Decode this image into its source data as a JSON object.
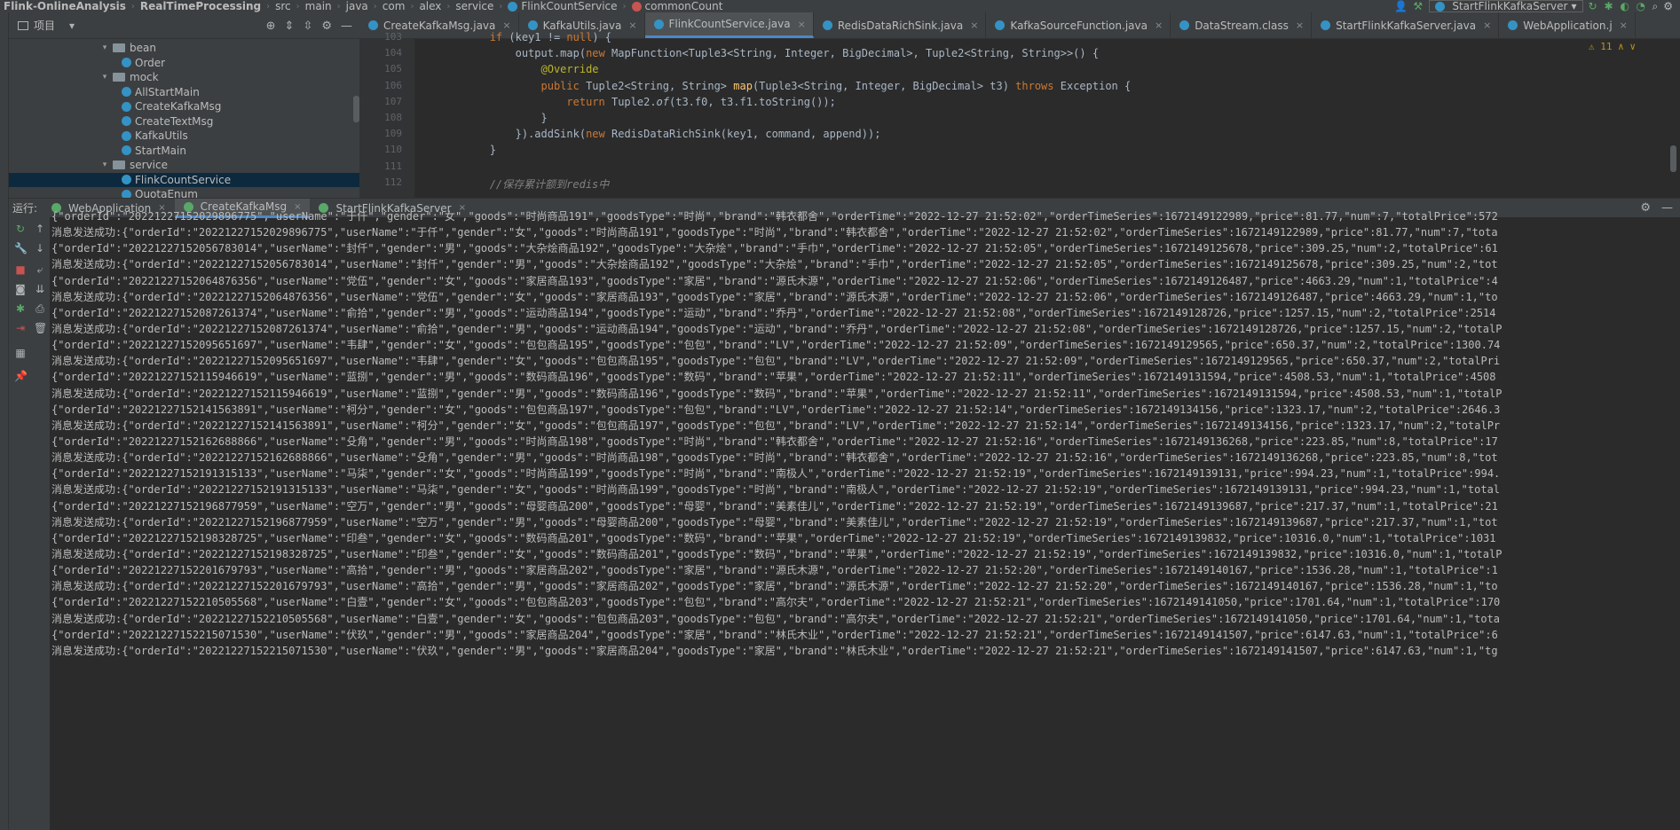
{
  "nav": {
    "crumbs": [
      "Flink-OnlineAnalysis",
      "RealTimeProcessing",
      "src",
      "main",
      "java",
      "com",
      "alex",
      "service",
      "FlinkCountService",
      "commonCount"
    ],
    "run_config": "StartFlinkKafkaServer"
  },
  "project": {
    "title": "项目",
    "tree": [
      {
        "label": "bean",
        "type": "folder",
        "indent": 1
      },
      {
        "label": "Order",
        "type": "class",
        "indent": 2
      },
      {
        "label": "mock",
        "type": "folder",
        "indent": 1
      },
      {
        "label": "AllStartMain",
        "type": "class",
        "indent": 2
      },
      {
        "label": "CreateKafkaMsg",
        "type": "class",
        "indent": 2
      },
      {
        "label": "CreateTextMsg",
        "type": "class",
        "indent": 2
      },
      {
        "label": "KafkaUtils",
        "type": "class",
        "indent": 2
      },
      {
        "label": "StartMain",
        "type": "class",
        "indent": 2
      },
      {
        "label": "service",
        "type": "folder",
        "indent": 1
      },
      {
        "label": "FlinkCountService",
        "type": "class",
        "indent": 2,
        "selected": true
      },
      {
        "label": "QuotaEnum",
        "type": "class",
        "indent": 2
      }
    ]
  },
  "editor": {
    "tabs": [
      {
        "label": "CreateKafkaMsg.java",
        "active": false
      },
      {
        "label": "KafkaUtils.java",
        "active": false
      },
      {
        "label": "FlinkCountService.java",
        "active": true
      },
      {
        "label": "RedisDataRichSink.java",
        "active": false
      },
      {
        "label": "KafkaSourceFunction.java",
        "active": false
      },
      {
        "label": "DataStream.class",
        "active": false
      },
      {
        "label": "StartFlinkKafkaServer.java",
        "active": false
      },
      {
        "label": "WebApplication.j",
        "active": false
      }
    ],
    "warning_count": "11",
    "line_numbers": [
      "103",
      "104",
      "105",
      "106",
      "107",
      "108",
      "109",
      "110",
      "111",
      "112"
    ],
    "lines": [
      "            if (key1 != null) {",
      "                output.map(new MapFunction<Tuple3<String, Integer, BigDecimal>, Tuple2<String, String>>() {",
      "                    @Override",
      "                    public Tuple2<String, String> map(Tuple3<String, Integer, BigDecimal> t3) throws Exception {",
      "                        return Tuple2.of(t3.f0, t3.f1.toString());",
      "                    }",
      "                }).addSink(new RedisDataRichSink(key1, command, append));",
      "            }",
      "",
      "            //保存累计额到redis中"
    ]
  },
  "run": {
    "label": "运行:",
    "tabs": [
      {
        "label": "WebApplication",
        "active": false
      },
      {
        "label": "CreateKafkaMsg",
        "active": true
      },
      {
        "label": "StartFlinkKafkaServer",
        "active": false
      }
    ],
    "console": [
      "{\"orderId\":\"20221227152029896775\",\"userName\":\"于仟\",\"gender\":\"女\",\"goods\":\"时尚商品191\",\"goodsType\":\"时尚\",\"brand\":\"韩衣都舍\",\"orderTime\":\"2022-12-27 21:52:02\",\"orderTimeSeries\":1672149122989,\"price\":81.77,\"num\":7,\"totalPrice\":572",
      "消息发送成功:{\"orderId\":\"20221227152029896775\",\"userName\":\"于仟\",\"gender\":\"女\",\"goods\":\"时尚商品191\",\"goodsType\":\"时尚\",\"brand\":\"韩衣都舍\",\"orderTime\":\"2022-12-27 21:52:02\",\"orderTimeSeries\":1672149122989,\"price\":81.77,\"num\":7,\"tota",
      "{\"orderId\":\"20221227152056783014\",\"userName\":\"封仟\",\"gender\":\"男\",\"goods\":\"大杂烩商品192\",\"goodsType\":\"大杂烩\",\"brand\":\"手巾\",\"orderTime\":\"2022-12-27 21:52:05\",\"orderTimeSeries\":1672149125678,\"price\":309.25,\"num\":2,\"totalPrice\":61",
      "消息发送成功:{\"orderId\":\"20221227152056783014\",\"userName\":\"封仟\",\"gender\":\"男\",\"goods\":\"大杂烩商品192\",\"goodsType\":\"大杂烩\",\"brand\":\"手巾\",\"orderTime\":\"2022-12-27 21:52:05\",\"orderTimeSeries\":1672149125678,\"price\":309.25,\"num\":2,\"tot",
      "{\"orderId\":\"20221227152064876356\",\"userName\":\"党伍\",\"gender\":\"女\",\"goods\":\"家居商品193\",\"goodsType\":\"家居\",\"brand\":\"源氏木源\",\"orderTime\":\"2022-12-27 21:52:06\",\"orderTimeSeries\":1672149126487,\"price\":4663.29,\"num\":1,\"totalPrice\":4",
      "消息发送成功:{\"orderId\":\"20221227152064876356\",\"userName\":\"党伍\",\"gender\":\"女\",\"goods\":\"家居商品193\",\"goodsType\":\"家居\",\"brand\":\"源氏木源\",\"orderTime\":\"2022-12-27 21:52:06\",\"orderTimeSeries\":1672149126487,\"price\":4663.29,\"num\":1,\"to",
      "{\"orderId\":\"20221227152087261374\",\"userName\":\"俞拾\",\"gender\":\"男\",\"goods\":\"运动商品194\",\"goodsType\":\"运动\",\"brand\":\"乔丹\",\"orderTime\":\"2022-12-27 21:52:08\",\"orderTimeSeries\":1672149128726,\"price\":1257.15,\"num\":2,\"totalPrice\":2514",
      "消息发送成功:{\"orderId\":\"20221227152087261374\",\"userName\":\"俞拾\",\"gender\":\"男\",\"goods\":\"运动商品194\",\"goodsType\":\"运动\",\"brand\":\"乔丹\",\"orderTime\":\"2022-12-27 21:52:08\",\"orderTimeSeries\":1672149128726,\"price\":1257.15,\"num\":2,\"totalP",
      "{\"orderId\":\"20221227152095651697\",\"userName\":\"韦肆\",\"gender\":\"女\",\"goods\":\"包包商品195\",\"goodsType\":\"包包\",\"brand\":\"LV\",\"orderTime\":\"2022-12-27 21:52:09\",\"orderTimeSeries\":1672149129565,\"price\":650.37,\"num\":2,\"totalPrice\":1300.74",
      "消息发送成功:{\"orderId\":\"20221227152095651697\",\"userName\":\"韦肆\",\"gender\":\"女\",\"goods\":\"包包商品195\",\"goodsType\":\"包包\",\"brand\":\"LV\",\"orderTime\":\"2022-12-27 21:52:09\",\"orderTimeSeries\":1672149129565,\"price\":650.37,\"num\":2,\"totalPri",
      "{\"orderId\":\"20221227152115946619\",\"userName\":\"蓝捌\",\"gender\":\"男\",\"goods\":\"数码商品196\",\"goodsType\":\"数码\",\"brand\":\"苹果\",\"orderTime\":\"2022-12-27 21:52:11\",\"orderTimeSeries\":1672149131594,\"price\":4508.53,\"num\":1,\"totalPrice\":4508",
      "消息发送成功:{\"orderId\":\"20221227152115946619\",\"userName\":\"蓝捌\",\"gender\":\"男\",\"goods\":\"数码商品196\",\"goodsType\":\"数码\",\"brand\":\"苹果\",\"orderTime\":\"2022-12-27 21:52:11\",\"orderTimeSeries\":1672149131594,\"price\":4508.53,\"num\":1,\"totalP",
      "{\"orderId\":\"20221227152141563891\",\"userName\":\"柯分\",\"gender\":\"女\",\"goods\":\"包包商品197\",\"goodsType\":\"包包\",\"brand\":\"LV\",\"orderTime\":\"2022-12-27 21:52:14\",\"orderTimeSeries\":1672149134156,\"price\":1323.17,\"num\":2,\"totalPrice\":2646.3",
      "消息发送成功:{\"orderId\":\"20221227152141563891\",\"userName\":\"柯分\",\"gender\":\"女\",\"goods\":\"包包商品197\",\"goodsType\":\"包包\",\"brand\":\"LV\",\"orderTime\":\"2022-12-27 21:52:14\",\"orderTimeSeries\":1672149134156,\"price\":1323.17,\"num\":2,\"totalPr",
      "{\"orderId\":\"20221227152162688866\",\"userName\":\"殳角\",\"gender\":\"男\",\"goods\":\"时尚商品198\",\"goodsType\":\"时尚\",\"brand\":\"韩衣都舍\",\"orderTime\":\"2022-12-27 21:52:16\",\"orderTimeSeries\":1672149136268,\"price\":223.85,\"num\":8,\"totalPrice\":17",
      "消息发送成功:{\"orderId\":\"20221227152162688866\",\"userName\":\"殳角\",\"gender\":\"男\",\"goods\":\"时尚商品198\",\"goodsType\":\"时尚\",\"brand\":\"韩衣都舍\",\"orderTime\":\"2022-12-27 21:52:16\",\"orderTimeSeries\":1672149136268,\"price\":223.85,\"num\":8,\"tot",
      "{\"orderId\":\"20221227152191315133\",\"userName\":\"马柒\",\"gender\":\"女\",\"goods\":\"时尚商品199\",\"goodsType\":\"时尚\",\"brand\":\"南极人\",\"orderTime\":\"2022-12-27 21:52:19\",\"orderTimeSeries\":1672149139131,\"price\":994.23,\"num\":1,\"totalPrice\":994.",
      "消息发送成功:{\"orderId\":\"20221227152191315133\",\"userName\":\"马柒\",\"gender\":\"女\",\"goods\":\"时尚商品199\",\"goodsType\":\"时尚\",\"brand\":\"南极人\",\"orderTime\":\"2022-12-27 21:52:19\",\"orderTimeSeries\":1672149139131,\"price\":994.23,\"num\":1,\"total",
      "{\"orderId\":\"20221227152196877959\",\"userName\":\"空万\",\"gender\":\"男\",\"goods\":\"母婴商品200\",\"goodsType\":\"母婴\",\"brand\":\"美素佳儿\",\"orderTime\":\"2022-12-27 21:52:19\",\"orderTimeSeries\":1672149139687,\"price\":217.37,\"num\":1,\"totalPrice\":21",
      "消息发送成功:{\"orderId\":\"20221227152196877959\",\"userName\":\"空万\",\"gender\":\"男\",\"goods\":\"母婴商品200\",\"goodsType\":\"母婴\",\"brand\":\"美素佳儿\",\"orderTime\":\"2022-12-27 21:52:19\",\"orderTimeSeries\":1672149139687,\"price\":217.37,\"num\":1,\"tot",
      "{\"orderId\":\"20221227152198328725\",\"userName\":\"印叁\",\"gender\":\"女\",\"goods\":\"数码商品201\",\"goodsType\":\"数码\",\"brand\":\"苹果\",\"orderTime\":\"2022-12-27 21:52:19\",\"orderTimeSeries\":1672149139832,\"price\":10316.0,\"num\":1,\"totalPrice\":1031",
      "消息发送成功:{\"orderId\":\"20221227152198328725\",\"userName\":\"印叁\",\"gender\":\"女\",\"goods\":\"数码商品201\",\"goodsType\":\"数码\",\"brand\":\"苹果\",\"orderTime\":\"2022-12-27 21:52:19\",\"orderTimeSeries\":1672149139832,\"price\":10316.0,\"num\":1,\"totalP",
      "{\"orderId\":\"20221227152201679793\",\"userName\":\"高拾\",\"gender\":\"男\",\"goods\":\"家居商品202\",\"goodsType\":\"家居\",\"brand\":\"源氏木源\",\"orderTime\":\"2022-12-27 21:52:20\",\"orderTimeSeries\":1672149140167,\"price\":1536.28,\"num\":1,\"totalPrice\":1",
      "消息发送成功:{\"orderId\":\"20221227152201679793\",\"userName\":\"高拾\",\"gender\":\"男\",\"goods\":\"家居商品202\",\"goodsType\":\"家居\",\"brand\":\"源氏木源\",\"orderTime\":\"2022-12-27 21:52:20\",\"orderTimeSeries\":1672149140167,\"price\":1536.28,\"num\":1,\"to",
      "{\"orderId\":\"20221227152210505568\",\"userName\":\"白壹\",\"gender\":\"女\",\"goods\":\"包包商品203\",\"goodsType\":\"包包\",\"brand\":\"高尔夫\",\"orderTime\":\"2022-12-27 21:52:21\",\"orderTimeSeries\":1672149141050,\"price\":1701.64,\"num\":1,\"totalPrice\":170",
      "消息发送成功:{\"orderId\":\"20221227152210505568\",\"userName\":\"白壹\",\"gender\":\"女\",\"goods\":\"包包商品203\",\"goodsType\":\"包包\",\"brand\":\"高尔夫\",\"orderTime\":\"2022-12-27 21:52:21\",\"orderTimeSeries\":1672149141050,\"price\":1701.64,\"num\":1,\"tota",
      "{\"orderId\":\"20221227152215071530\",\"userName\":\"伏玖\",\"gender\":\"男\",\"goods\":\"家居商品204\",\"goodsType\":\"家居\",\"brand\":\"林氏木业\",\"orderTime\":\"2022-12-27 21:52:21\",\"orderTimeSeries\":1672149141507,\"price\":6147.63,\"num\":1,\"totalPrice\":6",
      "消息发送成功:{\"orderId\":\"20221227152215071530\",\"userName\":\"伏玖\",\"gender\":\"男\",\"goods\":\"家居商品204\",\"goodsType\":\"家居\",\"brand\":\"林氏木业\",\"orderTime\":\"2022-12-27 21:52:21\",\"orderTimeSeries\":1672149141507,\"price\":6147.63,\"num\":1,\"tg"
    ]
  }
}
